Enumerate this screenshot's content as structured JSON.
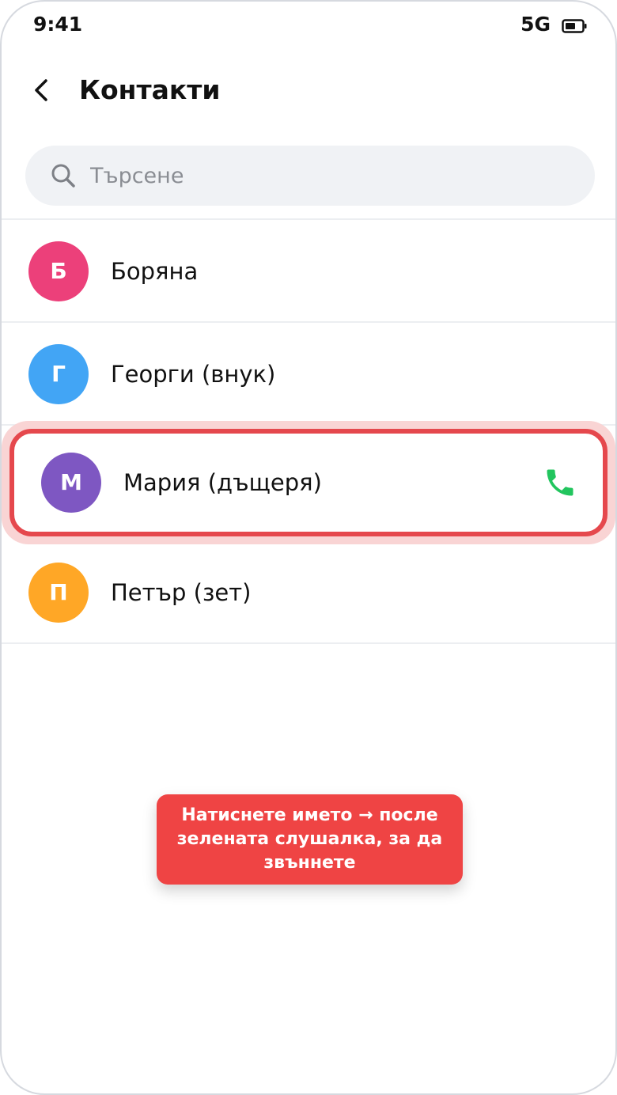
{
  "status_bar": {
    "time": "9:41",
    "network": "5G",
    "battery_icon": "battery-icon"
  },
  "header": {
    "back_icon": "chevron-left-icon",
    "title": "Контакти"
  },
  "search": {
    "icon": "search-icon",
    "placeholder": "Търсене",
    "value": ""
  },
  "contacts": [
    {
      "initial": "Б",
      "name": "Боряна",
      "color": "#ec407a"
    },
    {
      "initial": "Г",
      "name": "Георги (внук)",
      "color": "#42a5f5"
    },
    {
      "initial": "М",
      "name": "Мария (дъщеря)",
      "color": "#7e57c2",
      "highlighted": true,
      "action_icon": "phone-icon",
      "action_color": "#22c55e"
    },
    {
      "initial": "П",
      "name": "Петър (зет)",
      "color": "#ffa726"
    }
  ],
  "highlight_color": "#e5484d",
  "hint": {
    "line1": "Натиснете името → после",
    "line2": "зелената слушалка, за да звъннете",
    "color": "#ef4444"
  }
}
